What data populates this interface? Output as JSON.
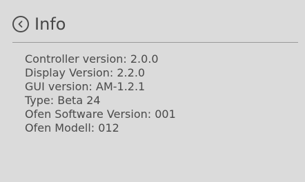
{
  "header": {
    "back_icon": "chevron-left-circle-icon",
    "title": "Info"
  },
  "info": [
    "Controller version: 2.0.0",
    "Display Version: 2.2.0",
    "GUI version: AM-1.2.1",
    "Type: Beta 24",
    "Ofen Software Version: 001",
    "Ofen Modell: 012"
  ]
}
